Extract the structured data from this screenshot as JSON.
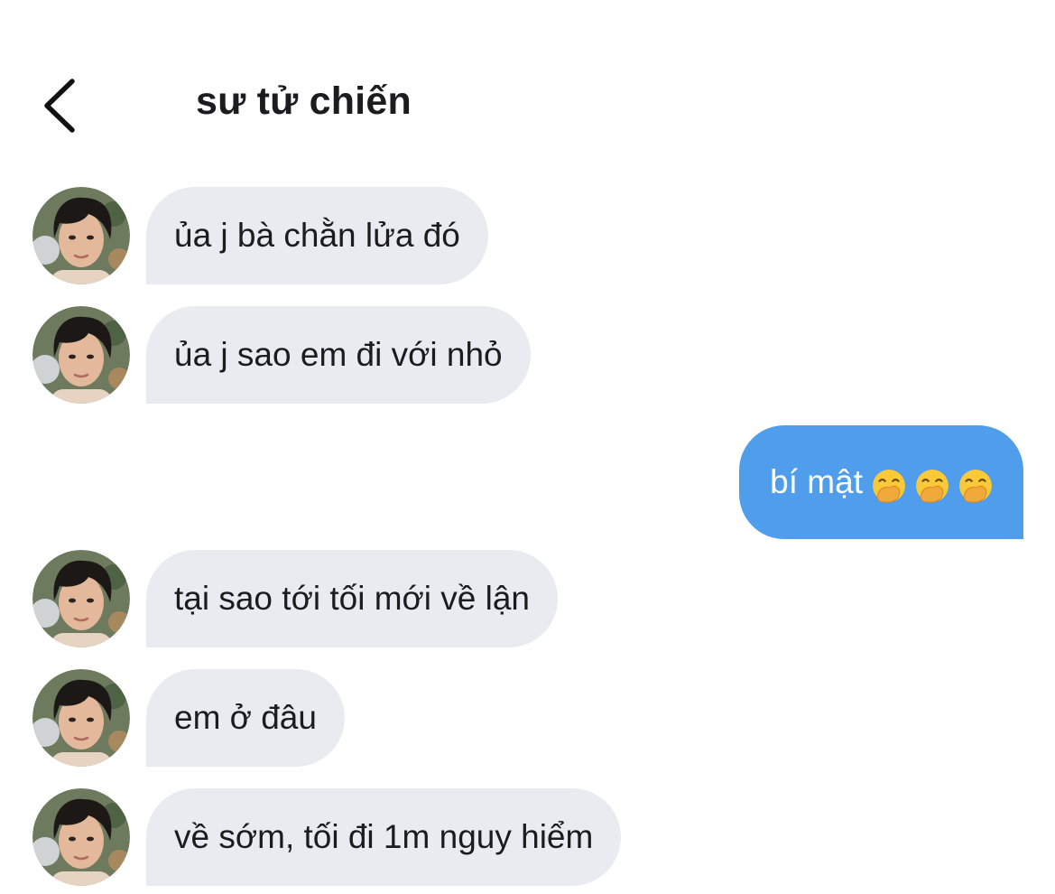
{
  "header": {
    "back_icon": "chevron-left-icon",
    "contact_name": "sư tử chiến"
  },
  "colors": {
    "incoming_bubble": "#e8ecf0",
    "outgoing_bubble": "#4f9deb",
    "text": "#1c1c1e"
  },
  "messages": [
    {
      "direction": "incoming",
      "text": "ủa j bà chằn lửa đó"
    },
    {
      "direction": "incoming",
      "text": "ủa j sao em đi với nhỏ"
    },
    {
      "direction": "outgoing",
      "text": "bí mật",
      "emojis": [
        "hand-over-mouth-emoji",
        "hand-over-mouth-emoji",
        "hand-over-mouth-emoji"
      ]
    },
    {
      "direction": "incoming",
      "text": "tại sao tới tối mới về lận"
    },
    {
      "direction": "incoming",
      "text": "em ở đâu"
    },
    {
      "direction": "incoming",
      "text": "về sớm, tối đi 1m nguy hiểm"
    }
  ]
}
